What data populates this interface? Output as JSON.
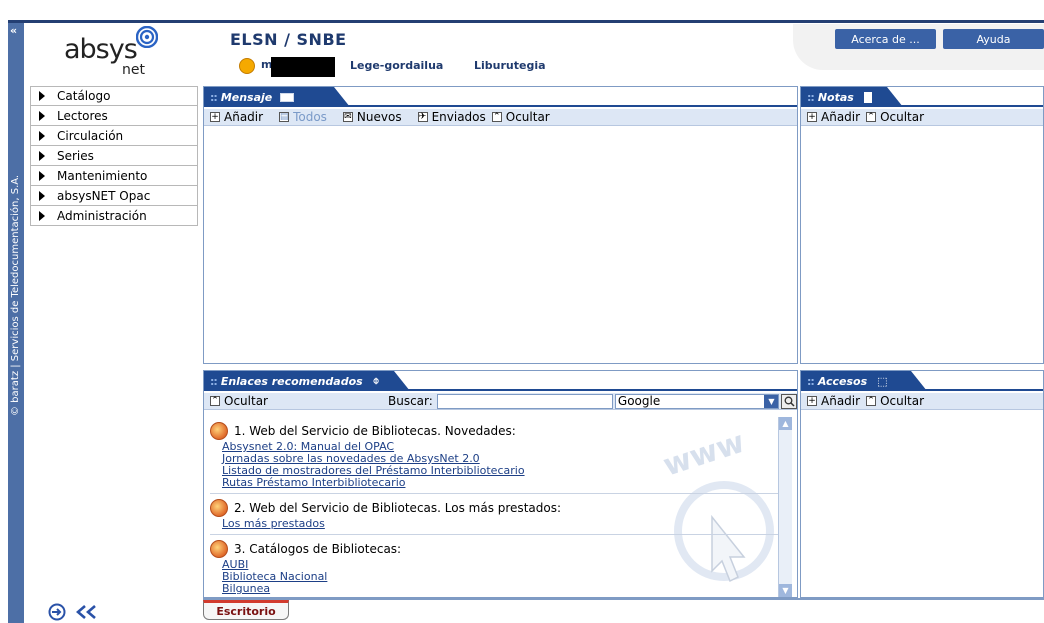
{
  "brand": {
    "word": "absys",
    "suffix": "net"
  },
  "side": {
    "vertical_text": "© baratz | Servicios de Teledocumentación, S.A.",
    "collapse_glyph": "«"
  },
  "menu": {
    "items": [
      {
        "label": "Catálogo"
      },
      {
        "label": "Lectores"
      },
      {
        "label": "Circulación"
      },
      {
        "label": "Series"
      },
      {
        "label": "Mantenimiento"
      },
      {
        "label": "absysNET Opac"
      },
      {
        "label": "Administración"
      }
    ]
  },
  "header": {
    "title": "ELSN / SNBE",
    "user_initial": "m",
    "links": {
      "lege": "Lege-gordailua",
      "liburutegia": "Liburutegia"
    },
    "buttons": {
      "about": "Acerca de ...",
      "help": "Ayuda"
    }
  },
  "mensaje": {
    "tab": "Mensaje",
    "toolbar": {
      "add": "Añadir",
      "all": "Todos",
      "new": "Nuevos",
      "sent": "Enviados",
      "hide": "Ocultar"
    }
  },
  "notas": {
    "tab": "Notas",
    "toolbar": {
      "add": "Añadir",
      "hide": "Ocultar"
    }
  },
  "enlaces": {
    "tab": "Enlaces recomendados",
    "toolbar": {
      "hide": "Ocultar",
      "search_label": "Buscar:",
      "search_value": "",
      "engine": "Google"
    },
    "sections": [
      {
        "title": "1. Web del Servicio de Bibliotecas. Novedades:",
        "links": [
          "Absysnet 2.0: Manual del OPAC",
          "Jornadas sobre las novedades de AbsysNet 2.0",
          "Listado de mostradores del Préstamo Interbibliotecario",
          "Rutas Préstamo Interbibliotecario"
        ]
      },
      {
        "title": "2. Web del Servicio de Bibliotecas. Los más prestados:",
        "links": [
          "Los más prestados"
        ]
      },
      {
        "title": "3. Catálogos de Bibliotecas:",
        "links": [
          "AUBI",
          "Biblioteca Nacional",
          "Bilgunea"
        ]
      }
    ]
  },
  "accesos": {
    "tab": "Accesos",
    "toolbar": {
      "add": "Añadir",
      "hide": "Ocultar"
    }
  },
  "footer": {
    "desk_tab": "Escritorio"
  },
  "colors": {
    "accent": "#1f4a92",
    "toolbar": "#dde7f5",
    "side_strip": "#4d6fa6",
    "button": "#3a62a6"
  },
  "icons": [
    "collapse-icon",
    "absys-logo-icon",
    "user-status-icon",
    "message-tab-icon",
    "notes-tab-icon",
    "attach-icon",
    "access-icon",
    "add-icon",
    "hide-icon",
    "search-go-icon",
    "globe-icon",
    "home-icon",
    "back-icon"
  ]
}
